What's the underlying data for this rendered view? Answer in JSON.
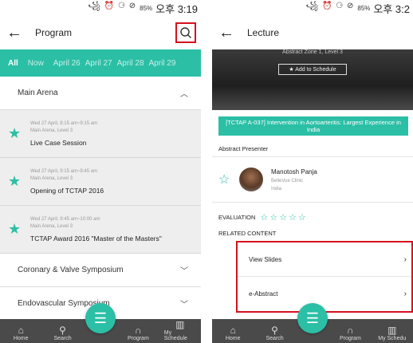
{
  "left": {
    "status": {
      "icons": "꧁ ⏰ ⚆ ⊘",
      "battery": "85%",
      "time": "오후 3:19"
    },
    "header": {
      "title": "Program"
    },
    "tabs": [
      "All",
      "Now",
      "April 26",
      "April 27",
      "April 28",
      "April 29"
    ],
    "sections": {
      "main_arena": "Main Arena",
      "coronary": "Coronary & Valve Symposium",
      "endovascular": "Endovascular Symposium"
    },
    "sessions": [
      {
        "date": "Wed 27 April, 8:15 am~9:15 am",
        "location": "Main Arena, Level 3",
        "title": "Live Case Session"
      },
      {
        "date": "Wed 27 April, 9:15 am~9:45 am",
        "location": "Main Arena, Level 3",
        "title": "Opening of TCTAP 2016"
      },
      {
        "date": "Wed 27 April, 9:45 am~10:00 am",
        "location": "Main Arena, Level 3",
        "title": "TCTAP Award 2016 \"Master of the Masters\""
      }
    ],
    "tabbar": {
      "home": "Home",
      "search": "Search",
      "program": "Program",
      "schedule": "My Schedule"
    }
  },
  "right": {
    "status": {
      "icons": "꧁ ⏰ ⚆ ⊘",
      "battery": "85%",
      "time": "오후 3:2"
    },
    "header": {
      "title": "Lecture"
    },
    "banner": {
      "location": "Abstract Zone 1, Level 3",
      "add_label": "★ Add to Schedule"
    },
    "abstract_title": "[TCTAP A-037] Intervention in Aortoarteritis: Largest Experience in India",
    "presenter_label": "Abstract Presenter",
    "presenter": {
      "name": "Manotosh Panja",
      "org": "BelleVue Clinic",
      "country": "India"
    },
    "evaluation_label": "EVALUATION",
    "related_label": "RELATED CONTENT",
    "related": [
      "View Slides",
      "e-Abstract"
    ],
    "tabbar": {
      "home": "Home",
      "search": "Search",
      "program": "Program",
      "schedule": "My Schedu"
    }
  },
  "colors": {
    "accent": "#2bbfa6",
    "highlight": "#d5121e",
    "tabbar": "#4a4a4a"
  },
  "icons": {
    "back": "arrow-left-icon",
    "search": "search-icon",
    "star": "star-icon",
    "chevron": "chevron-icon"
  }
}
